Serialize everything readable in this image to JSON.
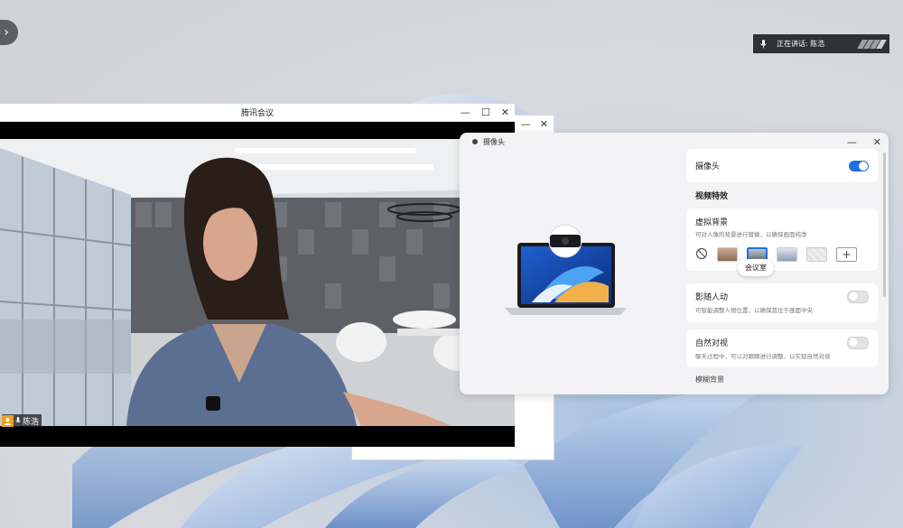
{
  "desktop": {
    "speaking_indicator": {
      "label": "正在讲话: 陈浩"
    }
  },
  "meeting_window": {
    "title": "腾讯会议",
    "participant": {
      "name": "陈浩"
    }
  },
  "camera_panel": {
    "title": "摄像头",
    "camera_toggle": {
      "label": "摄像头",
      "on": true
    },
    "section_title": "视频特效",
    "virtual_background": {
      "label": "虚拟背景",
      "description": "可对人像的背景进行替换，以确保画面纯净",
      "tooltip": "会议室",
      "add_label": "+"
    },
    "follow": {
      "label": "影随人动",
      "description": "可智能调整人物位置，以确保其位于画面中央",
      "on": false
    },
    "eye_contact": {
      "label": "自然对视",
      "description": "聊天过程中，可以对眼睛进行调整，以实现自然对视",
      "on": false
    },
    "clipped_item": "模糊背景"
  },
  "colors": {
    "accent": "#1e6fe0",
    "panel_bg": "#f3f3f5"
  }
}
